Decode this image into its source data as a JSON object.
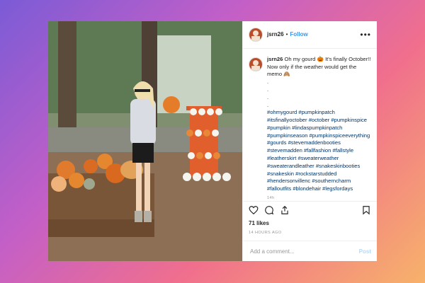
{
  "post": {
    "username": "jsrn26",
    "separator": "•",
    "follow_label": "Follow",
    "more_label": "•••",
    "caption": {
      "username": "jsrn26",
      "text": "Oh my gourd 🎃 It's finally October!! Now only if the weather would get the memo 🙈",
      "dots": [
        ".",
        ".",
        ".",
        "."
      ],
      "hashtags": [
        "#ohmygourd",
        "#pumpkinpatch",
        "#itsfinallyoctober",
        "#october",
        "#pumpkinspice",
        "#pumpkin",
        "#lindaspumpkinpatch",
        "#pumpkinseason",
        "#pumpkinspiceeverything",
        "#gourds",
        "#stevemaddenbooties",
        "#stevemadden",
        "#fallfashion",
        "#fallstyle",
        "#leatherskirt",
        "#sweaterweather",
        "#sweaterandleather",
        "#snakeskinbooties",
        "#snakeskin",
        "#rockstarstudded",
        "#hendersonvillenc",
        "#southerncharm",
        "#falloutfits",
        "#blondehair",
        "#legsfordays"
      ],
      "truncated": "14h"
    },
    "likes": "71 likes",
    "timestamp": "14 HOURS AGO",
    "comment_placeholder": "Add a comment...",
    "post_label": "Post"
  },
  "icons": {
    "like": "heart-icon",
    "comment": "comment-icon",
    "share": "share-icon",
    "save": "bookmark-icon",
    "more": "more-dots-icon"
  },
  "colors": {
    "link": "#3897f0",
    "hashtag": "#003569",
    "post_disabled": "#b3dbff"
  }
}
